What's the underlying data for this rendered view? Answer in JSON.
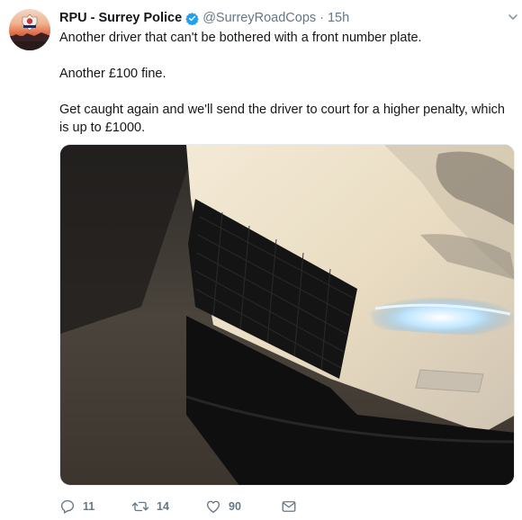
{
  "tweet": {
    "author_name": "RPU - Surrey Police",
    "handle": "@SurreyRoadCops",
    "separator": "·",
    "time": "15h",
    "paragraphs": [
      "Another driver that can't be bothered with a front number plate.",
      "Another £100 fine.",
      "Get caught again and we'll send the driver to court for a higher penalty, which is up to £1000."
    ],
    "counts": {
      "replies": "11",
      "retweets": "14",
      "likes": "90"
    }
  },
  "icons": {
    "verified": "verified-badge-icon",
    "caret": "chevron-down-icon",
    "reply": "reply-icon",
    "retweet": "retweet-icon",
    "like": "heart-icon",
    "message": "envelope-icon"
  },
  "colors": {
    "verified": "#1da1f2",
    "secondary_text": "#657786",
    "primary_text": "#14171a"
  }
}
